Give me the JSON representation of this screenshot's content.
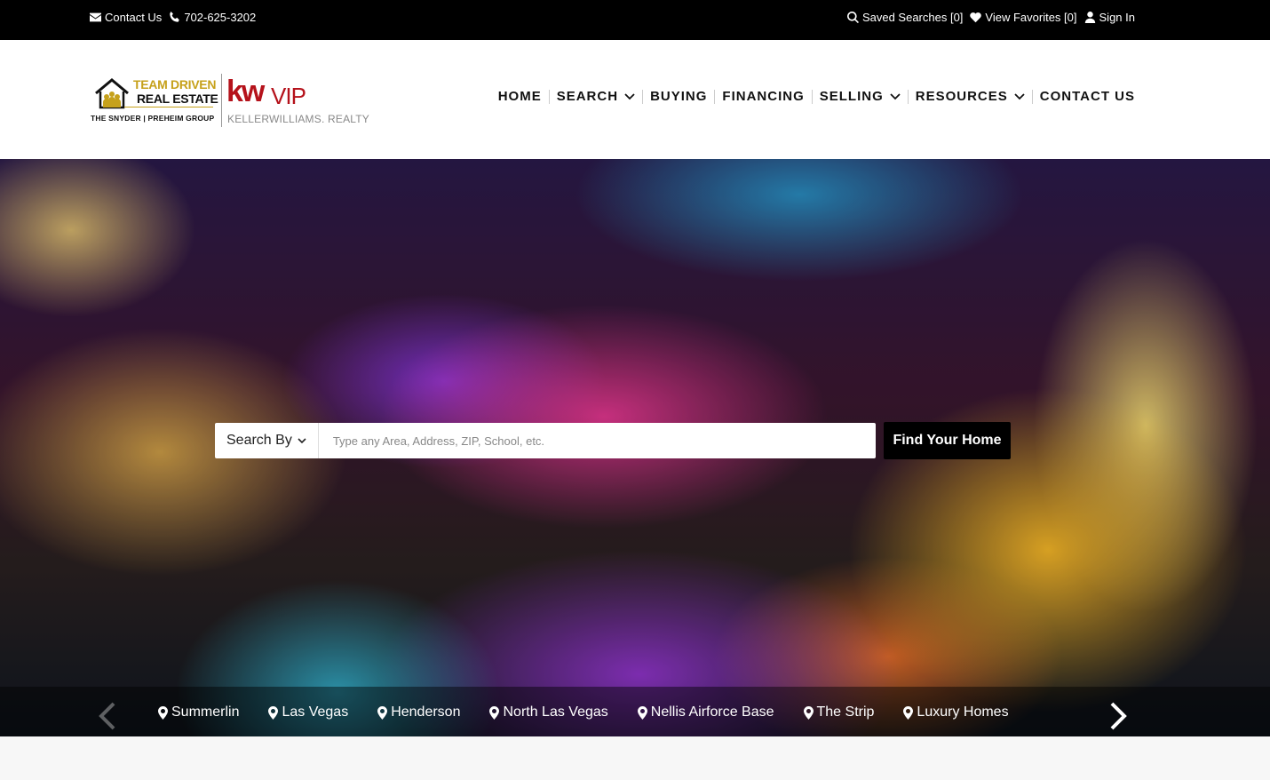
{
  "topbar": {
    "contact_label": "Contact Us",
    "phone": "702-625-3202",
    "saved_searches": "Saved Searches [0]",
    "view_favorites": "View Favorites [0]",
    "sign_in": "Sign In"
  },
  "logo": {
    "team_line1": "TEAM DRIVEN",
    "team_line2": "REAL ESTATE",
    "team_line3": "THE SNYDER | PREHEIM GROUP",
    "kw": "kw",
    "vip": "VIP",
    "kw_realty": "KELLERWILLIAMS. REALTY"
  },
  "nav": {
    "items": [
      {
        "label": "HOME",
        "dropdown": false
      },
      {
        "label": "SEARCH",
        "dropdown": true
      },
      {
        "label": "BUYING",
        "dropdown": false
      },
      {
        "label": "FINANCING",
        "dropdown": false
      },
      {
        "label": "SELLING",
        "dropdown": true
      },
      {
        "label": "RESOURCES",
        "dropdown": true
      },
      {
        "label": "CONTACT US",
        "dropdown": false
      }
    ]
  },
  "search": {
    "search_by_label": "Search By",
    "placeholder": "Type any Area, Address, ZIP, School, etc.",
    "button_label": "Find Your Home"
  },
  "areas": [
    "Summerlin",
    "Las Vegas",
    "Henderson",
    "North Las Vegas",
    "Nellis Airforce Base",
    "The Strip",
    "Luxury Homes"
  ],
  "colors": {
    "topbar_bg": "#000000",
    "logo_gold": "#c6a11b",
    "kw_red": "#b5121b",
    "button_bg": "#000000"
  }
}
